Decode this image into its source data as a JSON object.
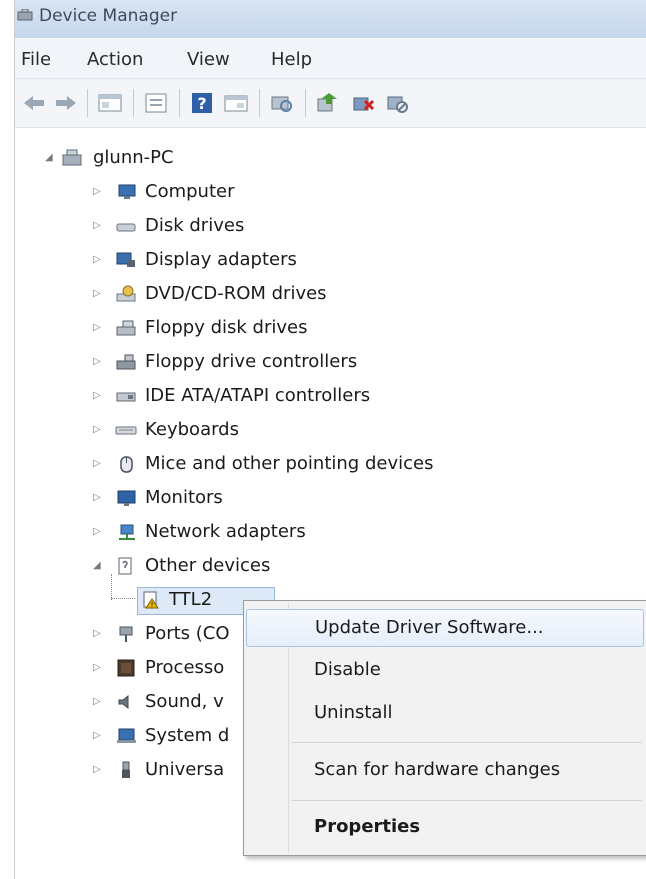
{
  "window": {
    "title": "Device Manager"
  },
  "menubar": {
    "items": [
      "File",
      "Action",
      "View",
      "Help"
    ]
  },
  "toolbar": {
    "buttons": [
      "back-icon",
      "forward-icon",
      "show-hide-tree-icon",
      "properties-icon",
      "help-icon",
      "show-hidden-icon",
      "scan-hardware-icon",
      "update-driver-icon",
      "uninstall-icon",
      "disable-icon"
    ]
  },
  "tree": {
    "root": "glunn-PC",
    "categories": [
      "Computer",
      "Disk drives",
      "Display adapters",
      "DVD/CD-ROM drives",
      "Floppy disk drives",
      "Floppy drive controllers",
      "IDE ATA/ATAPI controllers",
      "Keyboards",
      "Mice and other pointing devices",
      "Monitors",
      "Network adapters",
      "Other devices",
      "TTL2",
      "Ports (CO",
      "Processo",
      "Sound, v",
      "System d",
      "Universa"
    ]
  },
  "context_menu": {
    "items": [
      "Update Driver Software...",
      "Disable",
      "Uninstall",
      "Scan for hardware changes",
      "Properties"
    ],
    "highlighted": "Update Driver Software..."
  },
  "colors": {
    "titlebar": "#c6d7ec",
    "highlight_border": "#a8c4e6",
    "warning": "#e8b800"
  }
}
